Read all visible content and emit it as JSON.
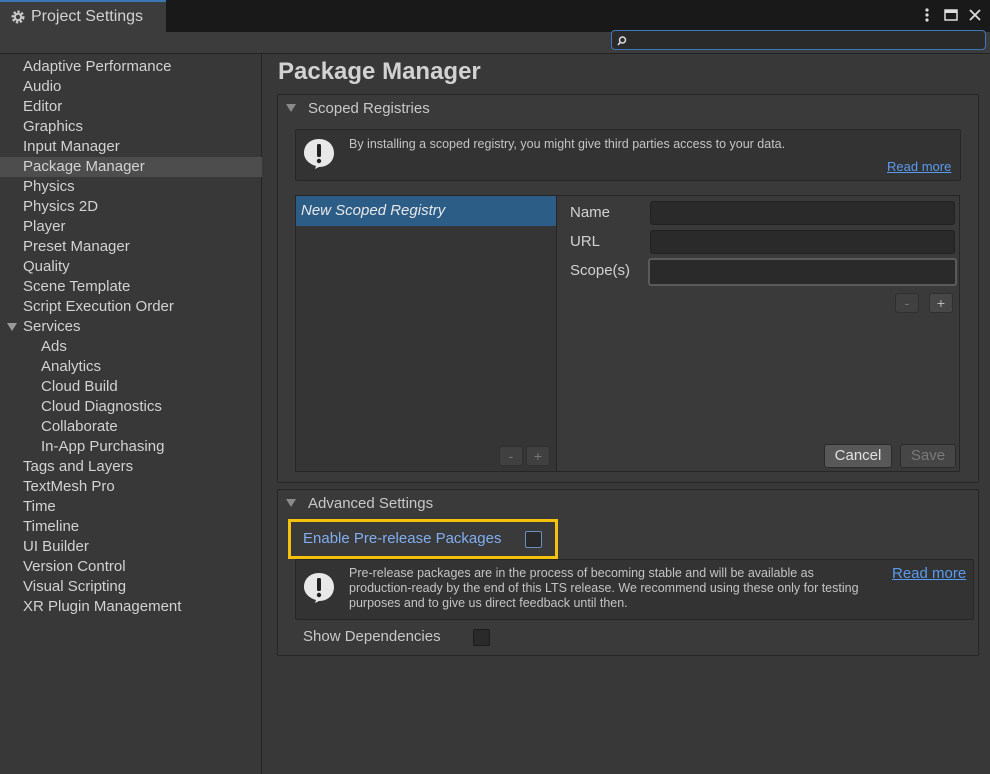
{
  "window": {
    "tab_title": "Project Settings",
    "search": {
      "value": "",
      "placeholder": ""
    }
  },
  "sidebar": {
    "items": [
      {
        "label": "Adaptive Performance"
      },
      {
        "label": "Audio"
      },
      {
        "label": "Editor"
      },
      {
        "label": "Graphics"
      },
      {
        "label": "Input Manager"
      },
      {
        "label": "Package Manager",
        "selected": true
      },
      {
        "label": "Physics"
      },
      {
        "label": "Physics 2D"
      },
      {
        "label": "Player"
      },
      {
        "label": "Preset Manager"
      },
      {
        "label": "Quality"
      },
      {
        "label": "Scene Template"
      },
      {
        "label": "Script Execution Order"
      },
      {
        "label": "Services",
        "expanded": true
      },
      {
        "label": "Ads",
        "child": true
      },
      {
        "label": "Analytics",
        "child": true
      },
      {
        "label": "Cloud Build",
        "child": true
      },
      {
        "label": "Cloud Diagnostics",
        "child": true
      },
      {
        "label": "Collaborate",
        "child": true
      },
      {
        "label": "In-App Purchasing",
        "child": true
      },
      {
        "label": "Tags and Layers"
      },
      {
        "label": "TextMesh Pro"
      },
      {
        "label": "Time"
      },
      {
        "label": "Timeline"
      },
      {
        "label": "UI Builder"
      },
      {
        "label": "Version Control"
      },
      {
        "label": "Visual Scripting"
      },
      {
        "label": "XR Plugin Management"
      }
    ]
  },
  "main": {
    "title": "Package Manager",
    "scoped": {
      "header": "Scoped Registries",
      "warning": "By installing a scoped registry, you might give third parties access to your data.",
      "read_more": "Read more",
      "registry_name": "New Scoped Registry",
      "name_label": "Name",
      "url_label": "URL",
      "scopes_label": "Scope(s)",
      "name_value": "",
      "url_value": "",
      "scopes_value": "",
      "minus": "-",
      "plus": "+",
      "cancel": "Cancel",
      "save": "Save"
    },
    "advanced": {
      "header": "Advanced Settings",
      "prerelease_label": "Enable Pre-release Packages",
      "prerelease_checked": false,
      "prerelease_info": "Pre-release packages are in the process of becoming stable and will be available as production-ready by the end of this LTS release. We recommend using these only for testing purposes and to give us direct feedback until then.",
      "read_more": "Read more",
      "show_deps_label": "Show Dependencies",
      "show_deps_checked": false
    }
  },
  "colors": {
    "highlight": "#f4c20d",
    "link": "#599bf0",
    "selection": "#2c5d87"
  }
}
